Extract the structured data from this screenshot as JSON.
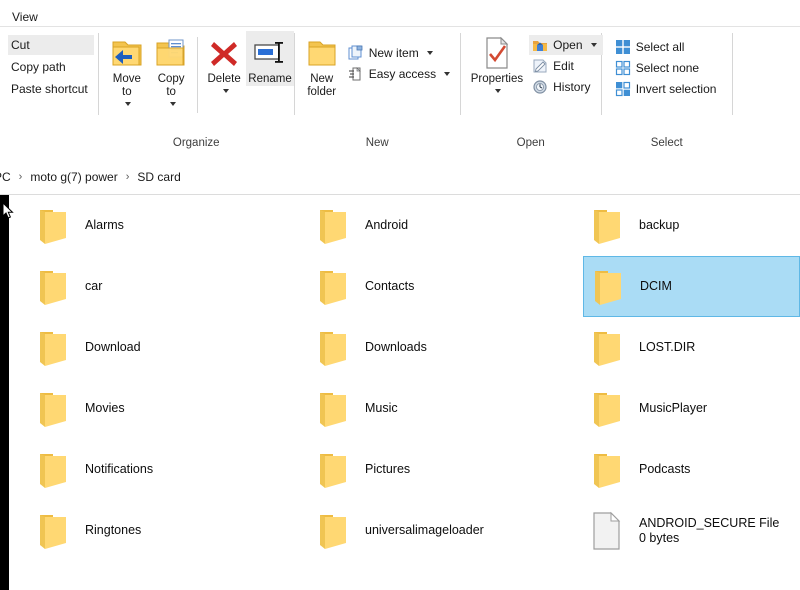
{
  "window": {
    "tabs": [
      {
        "label": "View"
      }
    ]
  },
  "ribbon": {
    "clipboard": {
      "items": [
        {
          "label": "Cut",
          "highlighted": true
        },
        {
          "label": "Copy path",
          "highlighted": false
        },
        {
          "label": "Paste shortcut",
          "highlighted": false
        }
      ]
    },
    "groups": [
      {
        "name": "organize",
        "label": "Organize"
      },
      {
        "name": "new",
        "label": "New"
      },
      {
        "name": "open",
        "label": "Open"
      },
      {
        "name": "select",
        "label": "Select"
      }
    ],
    "organize": {
      "move_to": "Move\nto",
      "copy_to": "Copy\nto",
      "delete": "Delete",
      "rename": "Rename"
    },
    "new": {
      "new_folder": "New\nfolder",
      "new_item": "New item",
      "easy_access": "Easy access"
    },
    "open_group": {
      "properties": "Properties",
      "open": "Open",
      "edit": "Edit",
      "history": "History"
    },
    "select": {
      "select_all": "Select all",
      "select_none": "Select none",
      "invert_selection": "Invert selection"
    }
  },
  "address": {
    "crumbs": [
      "PC",
      "moto g(7) power",
      "SD card"
    ],
    "separator": "›"
  },
  "colors": {
    "selection_fill": "#aadcf5",
    "selection_border": "#5fb8e6",
    "folder_back": "#f0bf45",
    "folder_front": "#ffd973",
    "ribbon_highlight": "#ececec"
  },
  "content": {
    "columns": [
      {
        "name": "column-1",
        "items": [
          {
            "name": "Alarms",
            "type": "folder",
            "selected": false
          },
          {
            "name": "car",
            "type": "folder",
            "selected": false
          },
          {
            "name": "Download",
            "type": "folder",
            "selected": false
          },
          {
            "name": "Movies",
            "type": "folder",
            "selected": false
          },
          {
            "name": "Notifications",
            "type": "folder",
            "selected": false
          },
          {
            "name": "Ringtones",
            "type": "folder",
            "selected": false
          }
        ]
      },
      {
        "name": "column-2",
        "items": [
          {
            "name": "Android",
            "type": "folder",
            "selected": false
          },
          {
            "name": "Contacts",
            "type": "folder",
            "selected": false
          },
          {
            "name": "Downloads",
            "type": "folder",
            "selected": false
          },
          {
            "name": "Music",
            "type": "folder",
            "selected": false
          },
          {
            "name": "Pictures",
            "type": "folder",
            "selected": false
          },
          {
            "name": "universalimageloader",
            "type": "folder",
            "selected": false
          }
        ]
      },
      {
        "name": "column-3",
        "items": [
          {
            "name": "backup",
            "type": "folder",
            "selected": false
          },
          {
            "name": "DCIM",
            "type": "folder",
            "selected": true
          },
          {
            "name": "LOST.DIR",
            "type": "folder",
            "selected": false
          },
          {
            "name": "MusicPlayer",
            "type": "folder",
            "selected": false
          },
          {
            "name": "Podcasts",
            "type": "folder",
            "selected": false
          },
          {
            "name": "ANDROID_SECURE File",
            "type": "file",
            "size": "0 bytes",
            "selected": false
          }
        ]
      }
    ]
  }
}
